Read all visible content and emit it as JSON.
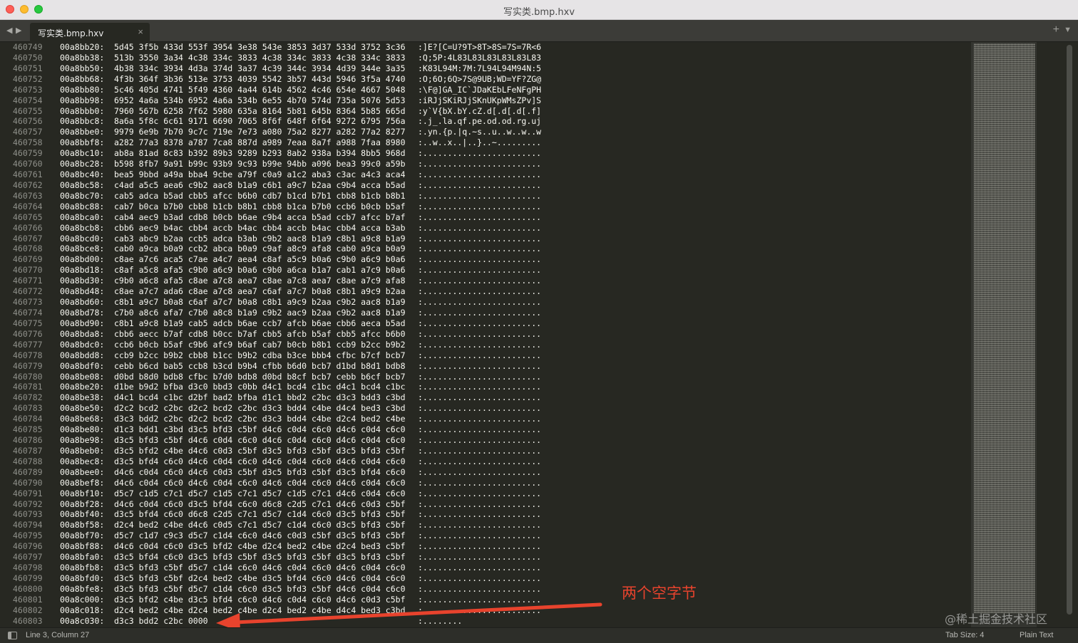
{
  "window": {
    "title": "写实类.bmp.hxv"
  },
  "tabs": {
    "active_label": "写实类.bmp.hxv",
    "close_glyph": "×",
    "plus_glyph": "+",
    "menu_glyph": "▼",
    "back_glyph": "◀",
    "forward_glyph": "▶"
  },
  "editor": {
    "lines": [
      {
        "ln": "460749",
        "addr": "00a8bb20:",
        "hex": "5d45 3f5b 433d 553f 3954 3e38 543e 3853 3d37 533d 3752 3c36",
        "ascii": ":]E?[C=U?9T>8T>8S=7S=7R<6"
      },
      {
        "ln": "460750",
        "addr": "00a8bb38:",
        "hex": "513b 3550 3a34 4c38 334c 3833 4c38 334c 3833 4c38 334c 3833",
        "ascii": ":Q;5P:4L83L83L83L83L83L83"
      },
      {
        "ln": "460751",
        "addr": "00a8bb50:",
        "hex": "4b38 334c 3934 4d3a 374d 3a37 4c39 344c 3934 4d39 344e 3a35",
        "ascii": ":K83L94M:7M:7L94L94M94N:5"
      },
      {
        "ln": "460752",
        "addr": "00a8bb68:",
        "hex": "4f3b 364f 3b36 513e 3753 4039 5542 3b57 443d 5946 3f5a 4740",
        "ascii": ":O;6O;6Q>7S@9UB;WD=YF?ZG@"
      },
      {
        "ln": "460753",
        "addr": "00a8bb80:",
        "hex": "5c46 405d 4741 5f49 4360 4a44 614b 4562 4c46 654e 4667 5048",
        "ascii": ":\\F@]GA_IC`JDaKEbLFeNFgPH"
      },
      {
        "ln": "460754",
        "addr": "00a8bb98:",
        "hex": "6952 4a6a 534b 6952 4a6a 534b 6e55 4b70 574d 735a 5076 5d53",
        "ascii": ":iRJjSKiRJjSKnUKpWMsZPv]S"
      },
      {
        "ln": "460755",
        "addr": "00a8bbb0:",
        "hex": "7960 567b 6258 7f62 5980 635a 8164 5b81 645b 8364 5b85 665d",
        "ascii": ":y`V{bX.bY.cZ.d[.d[.d[.f]"
      },
      {
        "ln": "460756",
        "addr": "00a8bbc8:",
        "hex": "8a6a 5f8c 6c61 9171 6690 7065 8f6f 648f 6f64 9272 6795 756a",
        "ascii": ":.j_.la.qf.pe.od.od.rg.uj"
      },
      {
        "ln": "460757",
        "addr": "00a8bbe0:",
        "hex": "9979 6e9b 7b70 9c7c 719e 7e73 a080 75a2 8277 a282 77a2 8277",
        "ascii": ":.yn.{p.|q.~s..u..w..w..w"
      },
      {
        "ln": "460758",
        "addr": "00a8bbf8:",
        "hex": "a282 77a3 8378 a787 7ca8 887d a989 7eaa 8a7f a988 7faa 8980",
        "ascii": ":..w..x..|..}..~........."
      },
      {
        "ln": "460759",
        "addr": "00a8bc10:",
        "hex": "ab8a 81ad 8c83 b392 89b3 9289 b293 8ab2 938a b394 8bb5 968d",
        "ascii": ":........................"
      },
      {
        "ln": "460760",
        "addr": "00a8bc28:",
        "hex": "b598 8fb7 9a91 b99c 93b9 9c93 b99e 94bb a096 bea3 99c0 a59b",
        "ascii": ":........................"
      },
      {
        "ln": "460761",
        "addr": "00a8bc40:",
        "hex": "bea5 9bbd a49a bba4 9cbe a79f c0a9 a1c2 aba3 c3ac a4c3 aca4",
        "ascii": ":........................"
      },
      {
        "ln": "460762",
        "addr": "00a8bc58:",
        "hex": "c4ad a5c5 aea6 c9b2 aac8 b1a9 c6b1 a9c7 b2aa c9b4 acca b5ad",
        "ascii": ":........................"
      },
      {
        "ln": "460763",
        "addr": "00a8bc70:",
        "hex": "cab5 adca b5ad cbb5 afcc b6b0 cdb7 b1cd b7b1 cbb8 b1cb b8b1",
        "ascii": ":........................"
      },
      {
        "ln": "460764",
        "addr": "00a8bc88:",
        "hex": "cab7 b0ca b7b0 cbb8 b1cb b8b1 cbb8 b1ca b7b0 ccb6 b0cb b5af",
        "ascii": ":........................"
      },
      {
        "ln": "460765",
        "addr": "00a8bca0:",
        "hex": "cab4 aec9 b3ad cdb8 b0cb b6ae c9b4 acca b5ad ccb7 afcc b7af",
        "ascii": ":........................"
      },
      {
        "ln": "460766",
        "addr": "00a8bcb8:",
        "hex": "cbb6 aec9 b4ac cbb4 accb b4ac cbb4 accb b4ac cbb4 acca b3ab",
        "ascii": ":........................"
      },
      {
        "ln": "460767",
        "addr": "00a8bcd0:",
        "hex": "cab3 abc9 b2aa ccb5 adca b3ab c9b2 aac8 b1a9 c8b1 a9c8 b1a9",
        "ascii": ":........................"
      },
      {
        "ln": "460768",
        "addr": "00a8bce8:",
        "hex": "cab0 a9ca b0a9 ccb2 abca b0a9 c9af a8c9 afa8 cab0 a9ca b0a9",
        "ascii": ":........................"
      },
      {
        "ln": "460769",
        "addr": "00a8bd00:",
        "hex": "c8ae a7c6 aca5 c7ae a4c7 aea4 c8af a5c9 b0a6 c9b0 a6c9 b0a6",
        "ascii": ":........................"
      },
      {
        "ln": "460770",
        "addr": "00a8bd18:",
        "hex": "c8af a5c8 afa5 c9b0 a6c9 b0a6 c9b0 a6ca b1a7 cab1 a7c9 b0a6",
        "ascii": ":........................"
      },
      {
        "ln": "460771",
        "addr": "00a8bd30:",
        "hex": "c9b0 a6c8 afa5 c8ae a7c8 aea7 c8ae a7c8 aea7 c8ae a7c9 afa8",
        "ascii": ":........................"
      },
      {
        "ln": "460772",
        "addr": "00a8bd48:",
        "hex": "c8ae a7c7 ada6 c8ae a7c8 aea7 c6af a7c7 b0a8 c8b1 a9c9 b2aa",
        "ascii": ":........................"
      },
      {
        "ln": "460773",
        "addr": "00a8bd60:",
        "hex": "c8b1 a9c7 b0a8 c6af a7c7 b0a8 c8b1 a9c9 b2aa c9b2 aac8 b1a9",
        "ascii": ":........................"
      },
      {
        "ln": "460774",
        "addr": "00a8bd78:",
        "hex": "c7b0 a8c6 afa7 c7b0 a8c8 b1a9 c9b2 aac9 b2aa c9b2 aac8 b1a9",
        "ascii": ":........................"
      },
      {
        "ln": "460775",
        "addr": "00a8bd90:",
        "hex": "c8b1 a9c8 b1a9 cab5 adcb b6ae ccb7 afcb b6ae cbb6 aeca b5ad",
        "ascii": ":........................"
      },
      {
        "ln": "460776",
        "addr": "00a8bda8:",
        "hex": "cbb6 aecc b7af cdb8 b0cc b7af cbb5 afcb b5af cbb5 afcc b6b0",
        "ascii": ":........................"
      },
      {
        "ln": "460777",
        "addr": "00a8bdc0:",
        "hex": "ccb6 b0cb b5af c9b6 afc9 b6af cab7 b0cb b8b1 ccb9 b2cc b9b2",
        "ascii": ":........................"
      },
      {
        "ln": "460778",
        "addr": "00a8bdd8:",
        "hex": "ccb9 b2cc b9b2 cbb8 b1cc b9b2 cdba b3ce bbb4 cfbc b7cf bcb7",
        "ascii": ":........................"
      },
      {
        "ln": "460779",
        "addr": "00a8bdf0:",
        "hex": "cebb b6cd bab5 ccb8 b3cd b9b4 cfbb b6d0 bcb7 d1bd b8d1 bdb8",
        "ascii": ":........................"
      },
      {
        "ln": "460780",
        "addr": "00a8be08:",
        "hex": "d0bd b8d0 bdb8 cfbc b7d0 bdb8 d0bd b8cf bcb7 cebb b6cf bcb7",
        "ascii": ":........................"
      },
      {
        "ln": "460781",
        "addr": "00a8be20:",
        "hex": "d1be b9d2 bfba d3c0 bbd3 c0bb d4c1 bcd4 c1bc d4c1 bcd4 c1bc",
        "ascii": ":........................"
      },
      {
        "ln": "460782",
        "addr": "00a8be38:",
        "hex": "d4c1 bcd4 c1bc d2bf bad2 bfba d1c1 bbd2 c2bc d3c3 bdd3 c3bd",
        "ascii": ":........................"
      },
      {
        "ln": "460783",
        "addr": "00a8be50:",
        "hex": "d2c2 bcd2 c2bc d2c2 bcd2 c2bc d3c3 bdd4 c4be d4c4 bed3 c3bd",
        "ascii": ":........................"
      },
      {
        "ln": "460784",
        "addr": "00a8be68:",
        "hex": "d3c3 bdd2 c2bc d2c2 bcd2 c2bc d3c3 bdd4 c4be d2c4 bed2 c4be",
        "ascii": ":........................"
      },
      {
        "ln": "460785",
        "addr": "00a8be80:",
        "hex": "d1c3 bdd1 c3bd d3c5 bfd3 c5bf d4c6 c0d4 c6c0 d4c6 c0d4 c6c0",
        "ascii": ":........................"
      },
      {
        "ln": "460786",
        "addr": "00a8be98:",
        "hex": "d3c5 bfd3 c5bf d4c6 c0d4 c6c0 d4c6 c0d4 c6c0 d4c6 c0d4 c6c0",
        "ascii": ":........................"
      },
      {
        "ln": "460787",
        "addr": "00a8beb0:",
        "hex": "d3c5 bfd2 c4be d4c6 c0d3 c5bf d3c5 bfd3 c5bf d3c5 bfd3 c5bf",
        "ascii": ":........................"
      },
      {
        "ln": "460788",
        "addr": "00a8bec8:",
        "hex": "d3c5 bfd4 c6c0 d4c6 c0d4 c6c0 d4c6 c0d4 c6c0 d4c6 c0d4 c6c0",
        "ascii": ":........................"
      },
      {
        "ln": "460789",
        "addr": "00a8bee0:",
        "hex": "d4c6 c0d4 c6c0 d4c6 c0d3 c5bf d3c5 bfd3 c5bf d3c5 bfd4 c6c0",
        "ascii": ":........................"
      },
      {
        "ln": "460790",
        "addr": "00a8bef8:",
        "hex": "d4c6 c0d4 c6c0 d4c6 c0d4 c6c0 d4c6 c0d4 c6c0 d4c6 c0d4 c6c0",
        "ascii": ":........................"
      },
      {
        "ln": "460791",
        "addr": "00a8bf10:",
        "hex": "d5c7 c1d5 c7c1 d5c7 c1d5 c7c1 d5c7 c1d5 c7c1 d4c6 c0d4 c6c0",
        "ascii": ":........................"
      },
      {
        "ln": "460792",
        "addr": "00a8bf28:",
        "hex": "d4c6 c0d4 c6c0 d3c5 bfd4 c6c0 d6c8 c2d5 c7c1 d4c6 c0d3 c5bf",
        "ascii": ":........................"
      },
      {
        "ln": "460793",
        "addr": "00a8bf40:",
        "hex": "d3c5 bfd4 c6c0 d6c8 c2d5 c7c1 d5c7 c1d4 c6c0 d3c5 bfd3 c5bf",
        "ascii": ":........................"
      },
      {
        "ln": "460794",
        "addr": "00a8bf58:",
        "hex": "d2c4 bed2 c4be d4c6 c0d5 c7c1 d5c7 c1d4 c6c0 d3c5 bfd3 c5bf",
        "ascii": ":........................"
      },
      {
        "ln": "460795",
        "addr": "00a8bf70:",
        "hex": "d5c7 c1d7 c9c3 d5c7 c1d4 c6c0 d4c6 c0d3 c5bf d3c5 bfd3 c5bf",
        "ascii": ":........................"
      },
      {
        "ln": "460796",
        "addr": "00a8bf88:",
        "hex": "d4c6 c0d4 c6c0 d3c5 bfd2 c4be d2c4 bed2 c4be d2c4 bed3 c5bf",
        "ascii": ":........................"
      },
      {
        "ln": "460797",
        "addr": "00a8bfa0:",
        "hex": "d3c5 bfd4 c6c0 d3c5 bfd3 c5bf d3c5 bfd3 c5bf d3c5 bfd3 c5bf",
        "ascii": ":........................"
      },
      {
        "ln": "460798",
        "addr": "00a8bfb8:",
        "hex": "d3c5 bfd3 c5bf d5c7 c1d4 c6c0 d4c6 c0d4 c6c0 d4c6 c0d4 c6c0",
        "ascii": ":........................"
      },
      {
        "ln": "460799",
        "addr": "00a8bfd0:",
        "hex": "d3c5 bfd3 c5bf d2c4 bed2 c4be d3c5 bfd4 c6c0 d4c6 c0d4 c6c0",
        "ascii": ":........................"
      },
      {
        "ln": "460800",
        "addr": "00a8bfe8:",
        "hex": "d3c5 bfd3 c5bf d5c7 c1d4 c6c0 d3c5 bfd3 c5bf d4c6 c0d4 c6c0",
        "ascii": ":........................"
      },
      {
        "ln": "460801",
        "addr": "00a8c000:",
        "hex": "d3c5 bfd2 c4be d3c5 bfd4 c6c0 d4c6 c0d4 c6c0 d4c6 c0d3 c5bf",
        "ascii": ":........................"
      },
      {
        "ln": "460802",
        "addr": "00a8c018:",
        "hex": "d2c4 bed2 c4be d2c4 bed2 c4be d2c4 bed2 c4be d4c4 bed3 c3bd",
        "ascii": ":........................"
      },
      {
        "ln": "460803",
        "addr": "00a8c030:",
        "hex": "d3c3 bdd2 c2bc 0000",
        "ascii": ":........"
      }
    ]
  },
  "annotation": {
    "text": "两个空字节",
    "color": "#e8432d"
  },
  "watermark": {
    "text": "@稀土掘金技术社区"
  },
  "statusbar": {
    "position": "Line 3, Column 27",
    "tab_size": "Tab Size: 4",
    "syntax": "Plain Text"
  },
  "colors": {
    "editor_bg": "#272822",
    "text": "#f8f8f2",
    "gutter_text": "#8f908a",
    "annotation": "#e8432d"
  }
}
